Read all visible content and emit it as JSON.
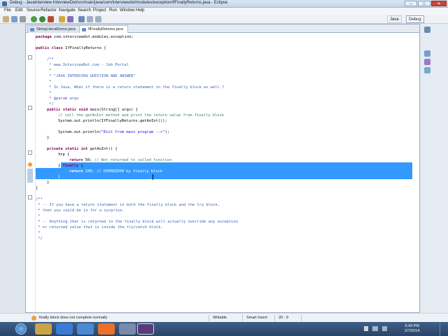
{
  "window": {
    "title": "Debug - JavaInterview-InterviewDot/src/main/java/com/interviewdot/modules/exception/IfFinallyReturns.java - Eclipse",
    "min": "–",
    "max": "□",
    "close": "✕"
  },
  "menu": [
    "File",
    "Edit",
    "Source",
    "Refactor",
    "Navigate",
    "Search",
    "Project",
    "Run",
    "Window",
    "Help"
  ],
  "perspectives": {
    "java": "Java",
    "debug": "Debug"
  },
  "tabs": [
    {
      "label": "StringLiteralDemo.java"
    },
    {
      "label": "IfFinallyReturns.java"
    }
  ],
  "code": {
    "l1_kw": "package",
    "l1": " com.interviewdot.modules.exception;",
    "l2_kw": "public class",
    "l2": " IfFinallyReturns {",
    "j1": "/**",
    "j2": " * www.InterviewDot.com - Job Portal",
    "j3": " *",
    "j4": " * \"JAVA INTERVIEW QUESTION AND ANSWER\"",
    "j5": " *",
    "j6": " * In Java, What if there is a return statement in the finally block as well ?",
    "j7": " *",
    "j8": " * @param args",
    "j9": " */",
    "m1_kw": "public static void",
    "m1": " main(String[] args) {",
    "m2": "// call the getAnInt method and print the return value from finally block",
    "m3": "System.out.println(IfFinallyReturns.getAnInt());",
    "m4a": "System.out.println(",
    "m4s": "\"Exit from main program -->\"",
    "m4b": ");",
    "m5": "}",
    "g1_kw": "private static int",
    "g1": " getAnInt() {",
    "g2_kw": "try",
    "g2": " {",
    "g3_kw": "return",
    "g3": " 50; ",
    "g3c": "// Not returned to called function",
    "g4a": "} ",
    "g4_kw": "finally",
    "g4b": " {",
    "g5_kw": "return",
    "g5": " 100; ",
    "g5c": "// OVERRIDEN by finally block",
    "g6": "}",
    "g7": "}",
    "g8": "}",
    "c1": "/**",
    "c2": " * -- If you have a return statement in both the finally block and the try block,",
    "c3": " * then you could be in for a surprise.",
    "c4": " *",
    "c5": " * -- Anything that is returned in the finally block will actually override any exception",
    "c6": " * or returned value that is inside the try/catch block.",
    "c7": " *",
    "c8": " */"
  },
  "status": {
    "message": "finally block does not complete normally",
    "writable": "Writable",
    "insert": "Smart Insert",
    "position": "26 : 9"
  },
  "clock": {
    "time": "5:43 PM",
    "date": "2/7/2014"
  },
  "colors": {
    "keyword": "#7f0055",
    "comment": "#3f7f5f",
    "javadoc": "#3f5fbf",
    "string": "#2a00ff",
    "selection": "#3399ff"
  }
}
